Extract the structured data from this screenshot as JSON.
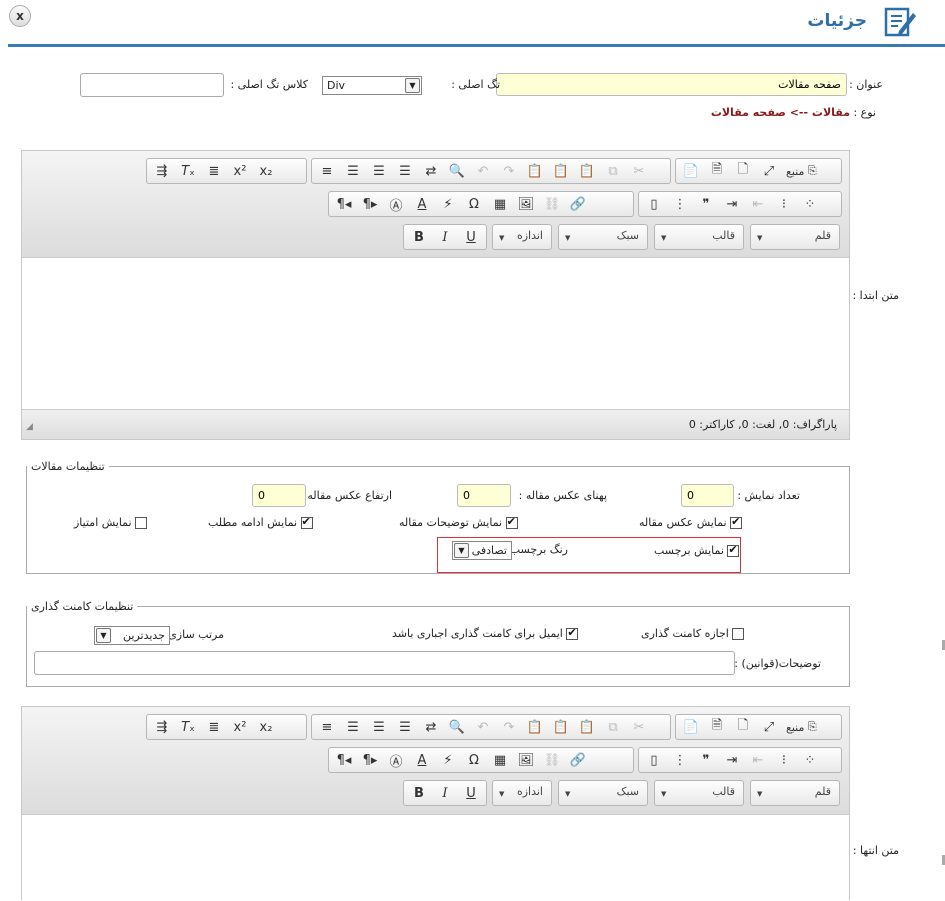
{
  "header": {
    "title": "جزئیات",
    "close_label": "x"
  },
  "form": {
    "title_label": "عنوان :",
    "title_value": "صفحه مقالات",
    "main_tag_label": "تگ اصلی :",
    "main_tag_value": "Div",
    "main_tag_class_label": "کلاس تگ اصلی :",
    "main_tag_class_value": "",
    "type_label": "نوع :",
    "type_value": "مقالات --> صفحه مقالات",
    "intro_text_label": "متن ابتدا :",
    "outro_text_label": "متن انتها :"
  },
  "toolbar": {
    "source_label": "منبع",
    "font_label": "قلم",
    "format_label": "قالب",
    "style_label": "سبک",
    "size_label": "اندازه",
    "bold": "B",
    "italic": "I",
    "underline": "U"
  },
  "editor1": {
    "status": "پاراگراف: 0, لغت: 0, کاراکتر: 0"
  },
  "article_settings": {
    "legend": "تنظیمات مقالات",
    "count_label": "تعداد نمایش :",
    "count_value": "0",
    "img_width_label": "پهنای عکس مقاله :",
    "img_width_value": "0",
    "img_height_label": "ارتفاع عکس مقاله :",
    "img_height_value": "0",
    "show_image_label": "نمایش عکس مقاله",
    "show_image": true,
    "show_desc_label": "نمایش توضیحات مقاله",
    "show_desc": true,
    "show_more_label": "نمایش ادامه مطلب",
    "show_more": true,
    "show_rating_label": "نمایش امتیاز",
    "show_rating": false,
    "show_tag_label": "نمایش برچسب",
    "show_tag": true,
    "tag_color_label": "رنگ برچسب",
    "tag_color_value": "تصادفی"
  },
  "comment_settings": {
    "legend": "تنظیمات کامنت گذاری",
    "allow_label": "اجازه کامنت گذاری",
    "allow": false,
    "email_required_label": "ایمیل برای کامنت گذاری اجباری باشد",
    "email_required": true,
    "sort_label": "مرتب سازی",
    "sort_value": "جدیدترین",
    "rules_label": "توضیحات(قوانین) :",
    "rules_value": ""
  },
  "colors": {
    "accent": "#2f6fa6",
    "type_text": "#8b1a1a",
    "highlight_border": "#d9323a",
    "yellow_field": "#ffffd6"
  }
}
